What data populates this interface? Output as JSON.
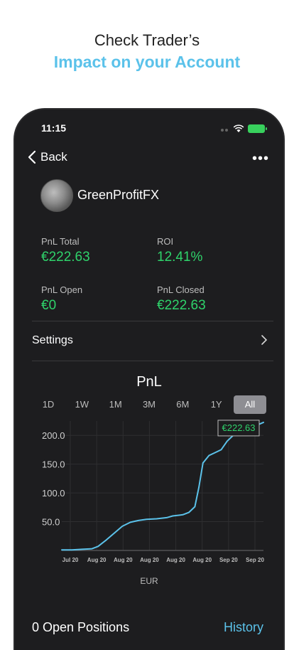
{
  "promo": {
    "line1": "Check Trader’s",
    "line2": "Impact on your Account"
  },
  "status_bar": {
    "time": "11:15"
  },
  "nav": {
    "back_label": "Back",
    "more_label": "•••"
  },
  "trader": {
    "name": "GreenProfitFX"
  },
  "stats": [
    {
      "label": "PnL Total",
      "value": "€222.63"
    },
    {
      "label": "ROI",
      "value": "12.41%"
    },
    {
      "label": "PnL Open",
      "value": "€0"
    },
    {
      "label": "PnL Closed",
      "value": "€222.63"
    }
  ],
  "settings": {
    "label": "Settings"
  },
  "ranges": {
    "items": [
      "1D",
      "1W",
      "1M",
      "3M",
      "6M",
      "1Y",
      "All"
    ],
    "active": "All"
  },
  "chart_data": {
    "type": "line",
    "title": "PnL",
    "xlabel": "EUR",
    "ylabel": "",
    "ylim": [
      0,
      225
    ],
    "y_ticks": [
      "200.0",
      "150.0",
      "100.0",
      "50.0"
    ],
    "x_ticks": [
      "Jul 20",
      "Aug 20",
      "Aug 20",
      "Aug 20",
      "Aug 20",
      "Aug 20",
      "Sep 20",
      "Sep 20"
    ],
    "tooltip": "€222.63",
    "line_color": "#5bc2ea",
    "series": [
      {
        "values": [
          [
            0,
            1
          ],
          [
            0.05,
            1
          ],
          [
            0.1,
            2
          ],
          [
            0.15,
            3
          ],
          [
            0.18,
            7
          ],
          [
            0.22,
            18
          ],
          [
            0.26,
            30
          ],
          [
            0.3,
            42
          ],
          [
            0.34,
            49
          ],
          [
            0.38,
            52
          ],
          [
            0.42,
            54
          ],
          [
            0.47,
            55
          ],
          [
            0.52,
            57
          ],
          [
            0.55,
            60
          ],
          [
            0.6,
            62
          ],
          [
            0.63,
            66
          ],
          [
            0.66,
            76
          ],
          [
            0.68,
            110
          ],
          [
            0.7,
            152
          ],
          [
            0.73,
            165
          ],
          [
            0.76,
            170
          ],
          [
            0.79,
            175
          ],
          [
            0.82,
            190
          ],
          [
            0.85,
            200
          ],
          [
            0.9,
            208
          ],
          [
            0.95,
            215
          ],
          [
            1.0,
            222.63
          ]
        ]
      }
    ]
  },
  "positions": {
    "open_label": "0 Open Positions",
    "history_label": "History"
  },
  "colors": {
    "accent": "#5bc2ea",
    "profit": "#2fd36b",
    "background": "#1d1d1f"
  }
}
